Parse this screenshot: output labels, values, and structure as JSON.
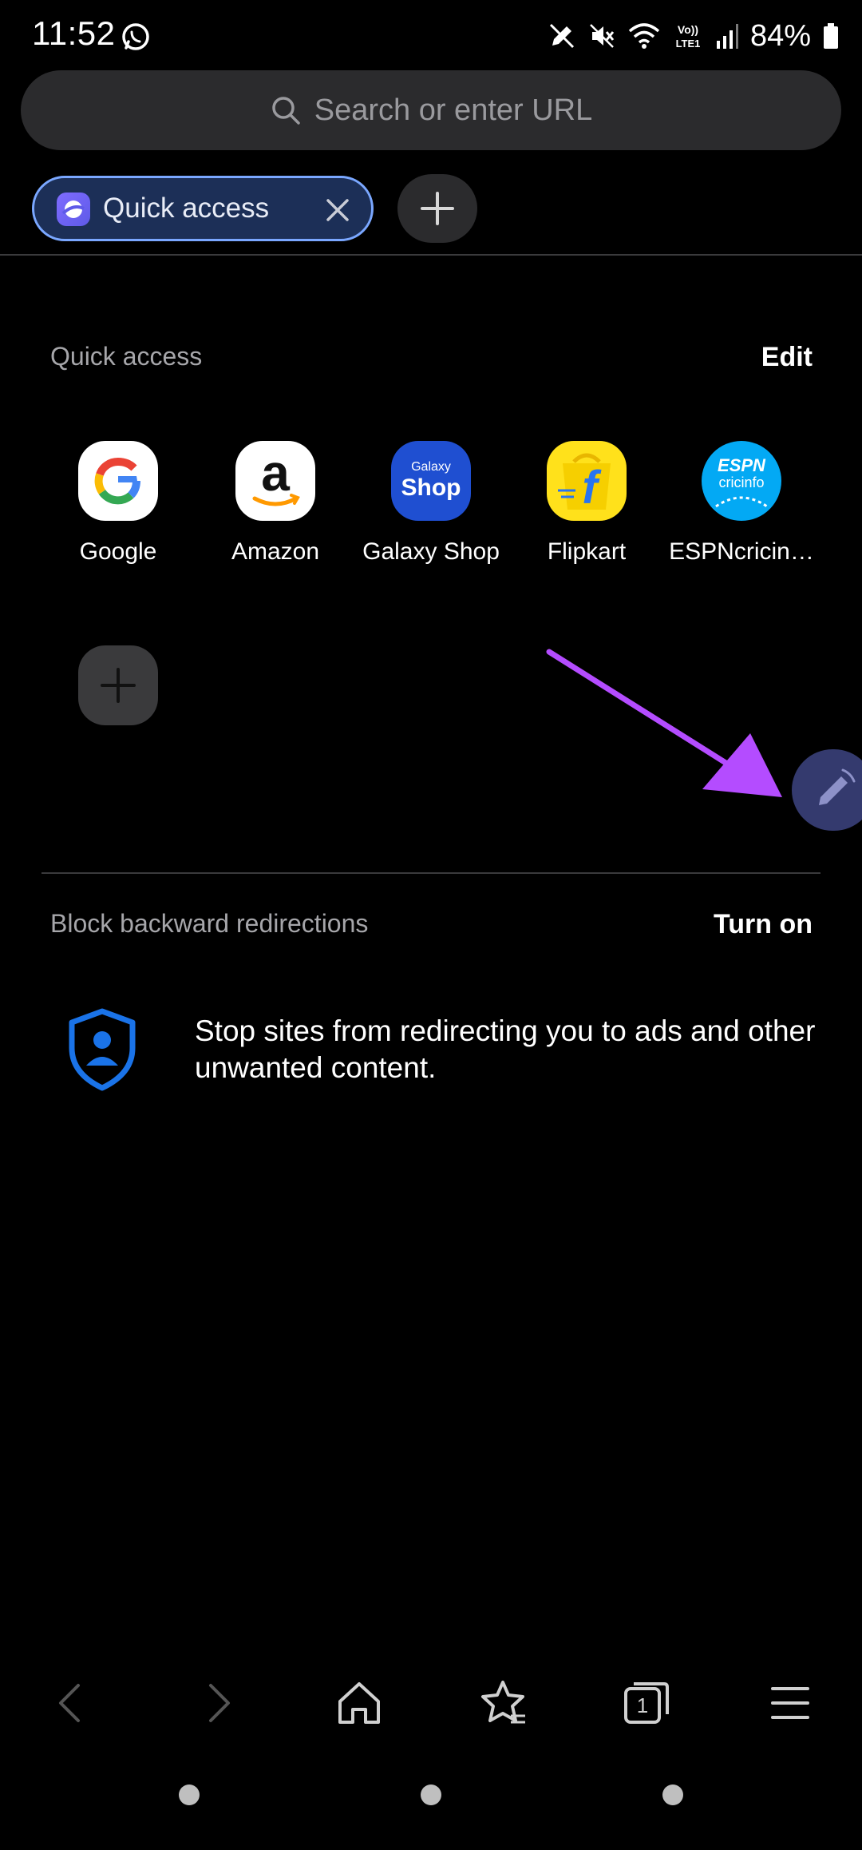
{
  "status_bar": {
    "time": "11:52",
    "battery": "84%",
    "icons": [
      "whatsapp-icon",
      "edit-pen-icon",
      "mute-icon",
      "wifi-icon",
      "volte-icon",
      "signal-icon",
      "battery-icon"
    ]
  },
  "search": {
    "placeholder": "Search or enter URL"
  },
  "tabs": [
    {
      "label": "Quick access",
      "active": true
    }
  ],
  "quick_access": {
    "title": "Quick access",
    "edit_label": "Edit",
    "items": [
      {
        "label": "Google",
        "icon": "google-icon"
      },
      {
        "label": "Amazon",
        "icon": "amazon-icon"
      },
      {
        "label": "Galaxy Shop",
        "icon": "galaxy-shop-icon",
        "icon_text_top": "Galaxy",
        "icon_text_bottom": "Shop"
      },
      {
        "label": "Flipkart",
        "icon": "flipkart-icon"
      },
      {
        "label": "ESPNcricin…",
        "icon": "espncricinfo-icon",
        "icon_text_top": "ESPN",
        "icon_text_bottom": "cricinfo"
      }
    ]
  },
  "block_redirections": {
    "title": "Block backward redirections",
    "action_label": "Turn on",
    "description": "Stop sites from redirecting you to ads and other unwanted content."
  },
  "toolbar": {
    "tab_count": "1",
    "icons": [
      "back-icon",
      "forward-icon",
      "home-icon",
      "bookmark-star-icon",
      "tabs-icon",
      "menu-icon"
    ]
  },
  "colors": {
    "background": "#000000",
    "accent_tab_border": "#7aa7ff",
    "annotation_arrow": "#b44cff",
    "shield_blue": "#1a73e8"
  }
}
